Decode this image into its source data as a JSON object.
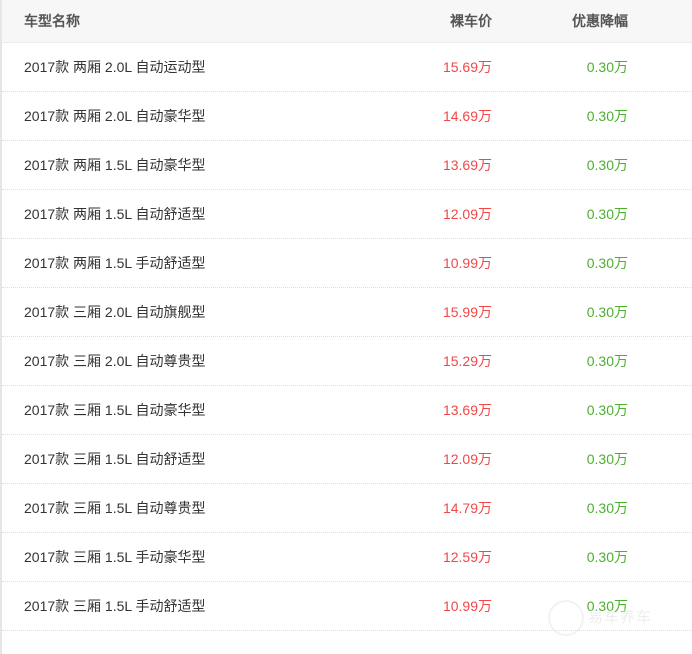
{
  "table": {
    "headers": {
      "name": "车型名称",
      "price": "裸车价",
      "discount": "优惠降幅"
    },
    "rows": [
      {
        "name": "2017款 两厢 2.0L 自动运动型",
        "price": "15.69万",
        "discount": "0.30万"
      },
      {
        "name": "2017款 两厢 2.0L 自动豪华型",
        "price": "14.69万",
        "discount": "0.30万"
      },
      {
        "name": "2017款 两厢 1.5L 自动豪华型",
        "price": "13.69万",
        "discount": "0.30万"
      },
      {
        "name": "2017款 两厢 1.5L 自动舒适型",
        "price": "12.09万",
        "discount": "0.30万"
      },
      {
        "name": "2017款 两厢 1.5L 手动舒适型",
        "price": "10.99万",
        "discount": "0.30万"
      },
      {
        "name": "2017款 三厢 2.0L 自动旗舰型",
        "price": "15.99万",
        "discount": "0.30万"
      },
      {
        "name": "2017款 三厢 2.0L 自动尊贵型",
        "price": "15.29万",
        "discount": "0.30万"
      },
      {
        "name": "2017款 三厢 1.5L 自动豪华型",
        "price": "13.69万",
        "discount": "0.30万"
      },
      {
        "name": "2017款 三厢 1.5L 自动舒适型",
        "price": "12.09万",
        "discount": "0.30万"
      },
      {
        "name": "2017款 三厢 1.5L 自动尊贵型",
        "price": "14.79万",
        "discount": "0.30万"
      },
      {
        "name": "2017款 三厢 1.5L 手动豪华型",
        "price": "12.59万",
        "discount": "0.30万"
      },
      {
        "name": "2017款 三厢 1.5L 手动舒适型",
        "price": "10.99万",
        "discount": "0.30万"
      }
    ]
  },
  "colors": {
    "price": "#f04848",
    "discount": "#4caf2f",
    "name": "#333333",
    "header_text": "#555555",
    "header_bg": "#f7f7f7"
  },
  "watermark": {
    "icon": "logo-circle-icon",
    "text": "易车养车"
  }
}
